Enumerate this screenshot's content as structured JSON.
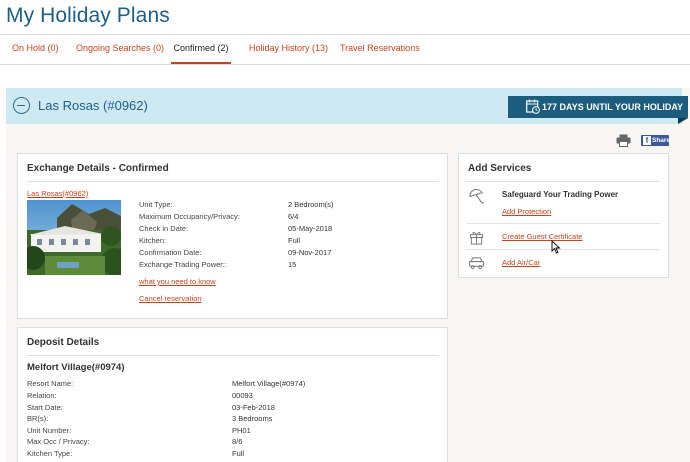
{
  "page": {
    "title": "My Holiday Plans"
  },
  "tabs": [
    {
      "label": "On Hold (0)",
      "active": false
    },
    {
      "label": "Ongoing Searches (0)",
      "active": false
    },
    {
      "label": "Confirmed (2)",
      "active": true
    },
    {
      "label": "Holiday History (13)",
      "active": false
    },
    {
      "label": "Travel Reservations",
      "active": false
    }
  ],
  "resort": {
    "title": "Las Rosas (#0962)",
    "countdown": "177 DAYS UNTIL YOUR HOLIDAY"
  },
  "share": {
    "label": "Share"
  },
  "exchange": {
    "title": "Exchange Details - Confirmed",
    "resort_link": "Las Rosas(#0962)",
    "details": [
      {
        "label": "Unit Type:",
        "value": "2 Bedroom(s)"
      },
      {
        "label": "Maximum Occupancy/Privacy:",
        "value": "6/4"
      },
      {
        "label": "Check in Date:",
        "value": "05-May-2018"
      },
      {
        "label": "Kitchen:",
        "value": "Full"
      },
      {
        "label": "Confirmation Date:",
        "value": "09-Nov-2017"
      },
      {
        "label": "Exchange Trading Power::",
        "value": "15"
      }
    ],
    "info_link": "what you need to know",
    "cancel_link": "Cancel reservation"
  },
  "services": {
    "title": "Add Services",
    "safeguard_heading": "Safeguard Your Trading Power",
    "protection_link": "Add Protection",
    "guest_certificate_link": "Create Guest Certificate",
    "air_car_link": "Add Air/Car"
  },
  "deposit": {
    "title": "Deposit Details",
    "resort_name": "Melfort Village(#0974)",
    "details": [
      {
        "label": "Resort Name:",
        "value": "Melfort Village(#0974)"
      },
      {
        "label": "Relation:",
        "value": "00093"
      },
      {
        "label": "Start Date:",
        "value": "03-Feb-2018"
      },
      {
        "label": "BR(s):",
        "value": "3 Bedrooms"
      },
      {
        "label": "Unit Number:",
        "value": "PH01"
      },
      {
        "label": "Max Occ / Privacy:",
        "value": "8/6"
      },
      {
        "label": "Kitchen Type:",
        "value": "Full"
      }
    ]
  },
  "colors": {
    "accent": "#c9431a",
    "title_blue": "#1d5f8a",
    "badge": "#1c5c7f",
    "banner": "#cfe9f3"
  }
}
